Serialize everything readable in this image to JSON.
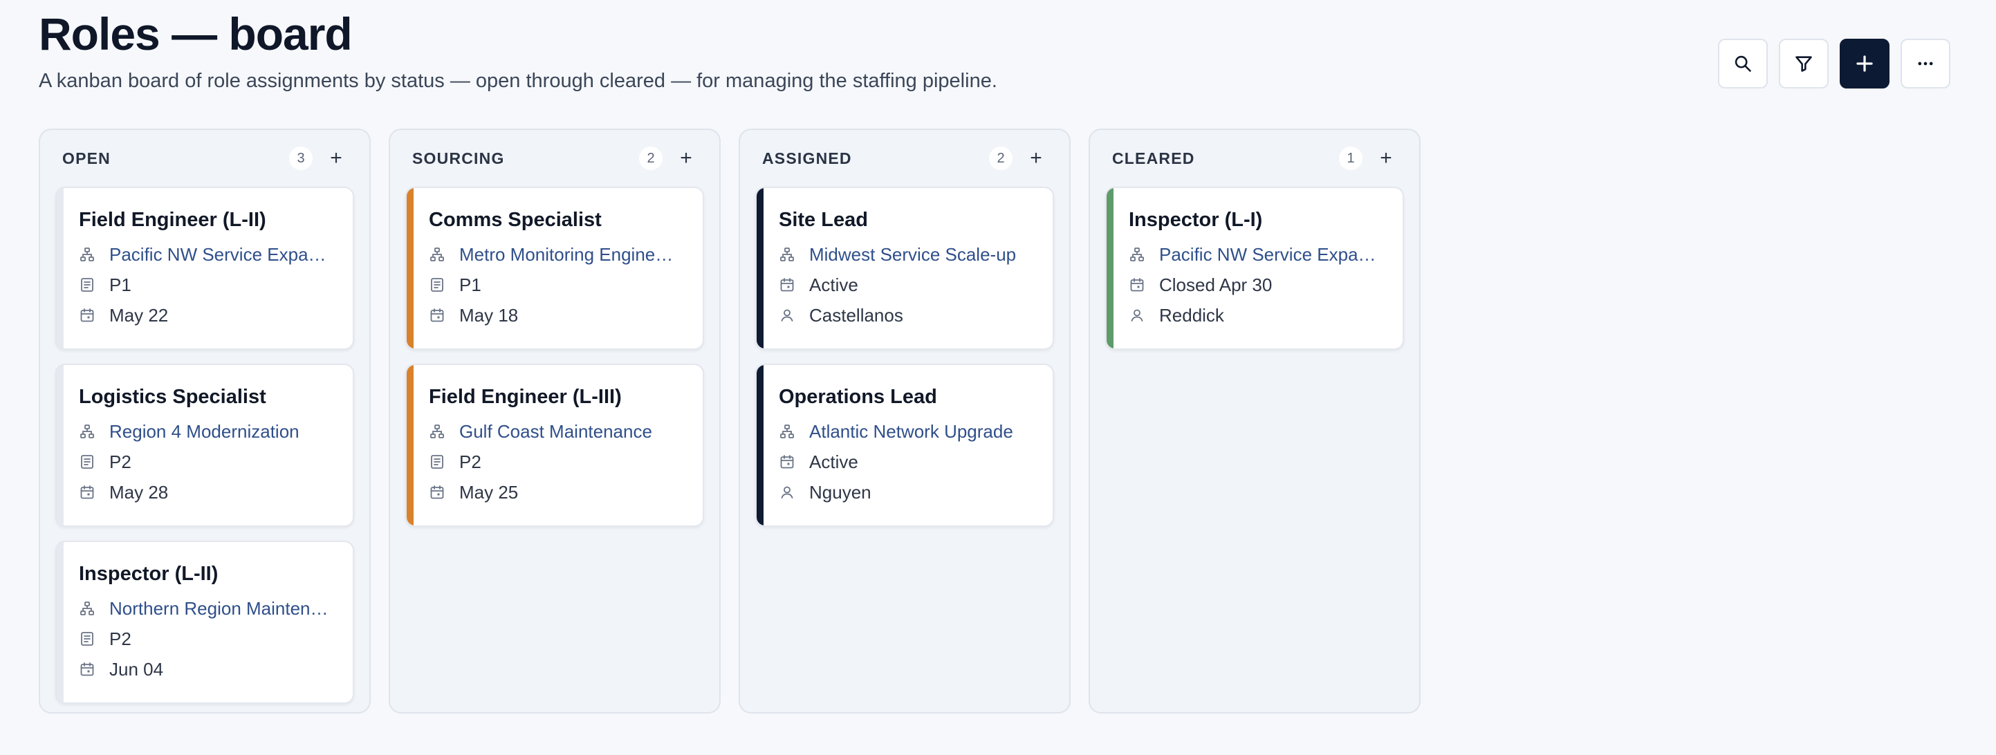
{
  "header": {
    "title": "Roles — board",
    "subtitle": "A kanban board of role assignments by status — open through cleared — for managing the staffing pipeline."
  },
  "toolbar": {
    "buttons": [
      {
        "name": "search-button",
        "icon": "search-icon"
      },
      {
        "name": "filter-button",
        "icon": "filter-icon"
      },
      {
        "name": "add-button",
        "icon": "plus-icon"
      },
      {
        "name": "more-button",
        "icon": "more-horizontal-icon"
      }
    ],
    "colors": {
      "primary": "#0d1a33"
    }
  },
  "columns": [
    {
      "key": "open",
      "title": "OPEN",
      "count": "3",
      "add": "+",
      "accent": "#e6eaf0",
      "cards": [
        {
          "title": "Field Engineer (L-II)",
          "project": "Pacific NW Service Expan...",
          "second": "P1",
          "second_icon": "list-icon",
          "third": "May 22",
          "third_icon": "calendar-icon"
        },
        {
          "title": "Logistics Specialist",
          "project": "Region 4 Modernization",
          "second": "P2",
          "second_icon": "list-icon",
          "third": "May 28",
          "third_icon": "calendar-icon"
        },
        {
          "title": "Inspector (L-II)",
          "project": "Northern Region Maintena...",
          "second": "P2",
          "second_icon": "list-icon",
          "third": "Jun 04",
          "third_icon": "calendar-icon"
        }
      ]
    },
    {
      "key": "sourcing",
      "title": "SOURCING",
      "count": "2",
      "add": "+",
      "accent": "#d9822b",
      "cards": [
        {
          "title": "Comms Specialist",
          "project": "Metro Monitoring Engineer...",
          "second": "P1",
          "second_icon": "list-icon",
          "third": "May 18",
          "third_icon": "calendar-icon"
        },
        {
          "title": "Field Engineer (L-III)",
          "project": "Gulf Coast Maintenance",
          "second": "P2",
          "second_icon": "list-icon",
          "third": "May 25",
          "third_icon": "calendar-icon"
        }
      ]
    },
    {
      "key": "assigned",
      "title": "ASSIGNED",
      "count": "2",
      "add": "+",
      "accent": "#0f1a33",
      "cards": [
        {
          "title": "Site Lead",
          "project": "Midwest Service Scale-up",
          "second": "Active",
          "second_icon": "calendar-icon",
          "third": "Castellanos",
          "third_icon": "person-icon"
        },
        {
          "title": "Operations Lead",
          "project": "Atlantic Network Upgrade",
          "second": "Active",
          "second_icon": "calendar-icon",
          "third": "Nguyen",
          "third_icon": "person-icon"
        }
      ]
    },
    {
      "key": "cleared",
      "title": "CLEARED",
      "count": "1",
      "add": "+",
      "accent": "#5f9a6b",
      "cards": [
        {
          "title": "Inspector (L-I)",
          "project": "Pacific NW Service Expan...",
          "second": "Closed Apr 30",
          "second_icon": "calendar-icon",
          "third": "Reddick",
          "third_icon": "person-icon"
        }
      ]
    }
  ]
}
